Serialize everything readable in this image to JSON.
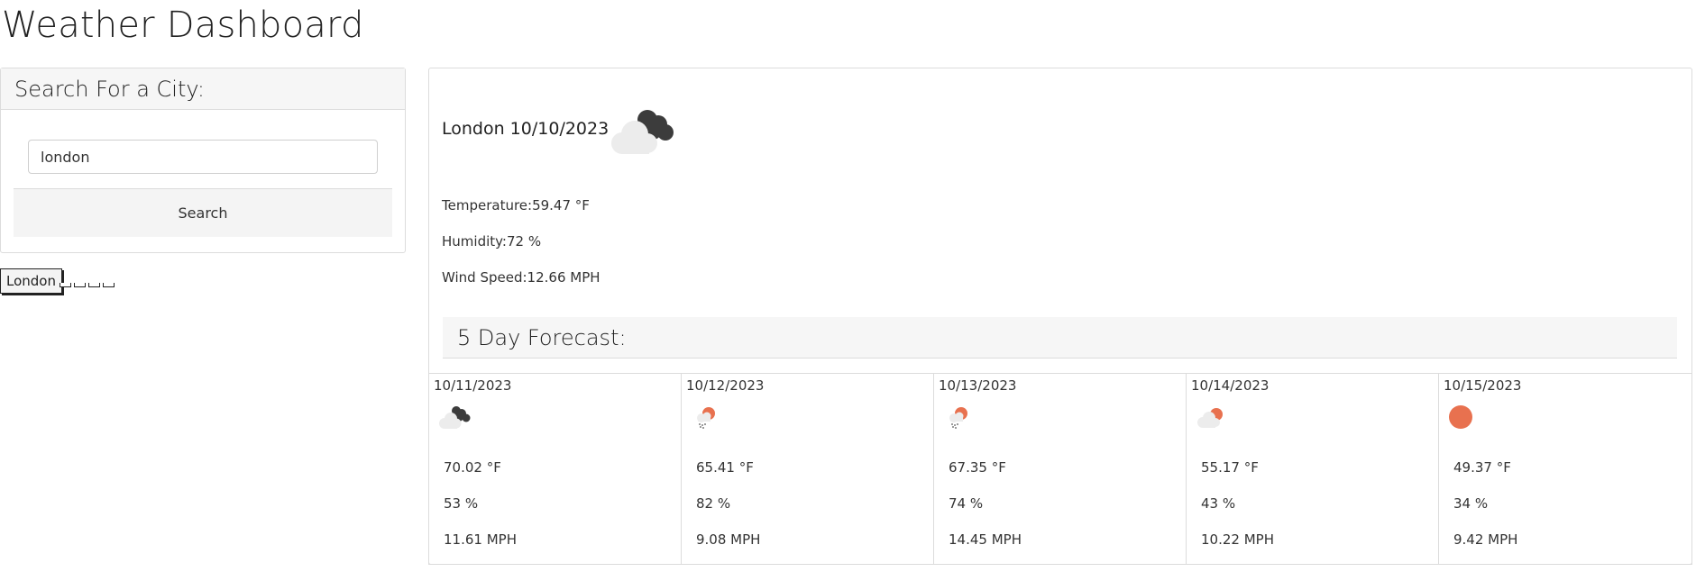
{
  "header": {
    "title": "Weather Dashboard"
  },
  "search": {
    "heading": "Search For a City:",
    "input_value": "london",
    "button_label": "Search"
  },
  "history": {
    "cities": [
      "London"
    ]
  },
  "current": {
    "title": "London 10/10/2023",
    "icon": "clouds-icon",
    "temperature": "Temperature:59.47 °F",
    "humidity": "Humidity:72 %",
    "wind": "Wind Speed:12.66  MPH"
  },
  "forecast": {
    "heading": "5 Day Forecast:",
    "days": [
      {
        "date": "10/11/2023",
        "icon": "clouds-icon",
        "temp": "70.02 °F",
        "humidity": "53 %",
        "wind": "11.61  MPH"
      },
      {
        "date": "10/12/2023",
        "icon": "rain-sun-icon",
        "temp": "65.41 °F",
        "humidity": "82 %",
        "wind": "9.08  MPH"
      },
      {
        "date": "10/13/2023",
        "icon": "rain-sun-icon",
        "temp": "67.35 °F",
        "humidity": "74 %",
        "wind": "14.45  MPH"
      },
      {
        "date": "10/14/2023",
        "icon": "cloud-sun-icon",
        "temp": "55.17 °F",
        "humidity": "43 %",
        "wind": "10.22  MPH"
      },
      {
        "date": "10/15/2023",
        "icon": "sun-icon",
        "temp": "49.37 °F",
        "humidity": "34 %",
        "wind": "9.42  MPH"
      }
    ]
  },
  "colors": {
    "sun": "#e8714f",
    "dark_cloud": "#3c3c3c",
    "light_cloud": "#ececec"
  }
}
